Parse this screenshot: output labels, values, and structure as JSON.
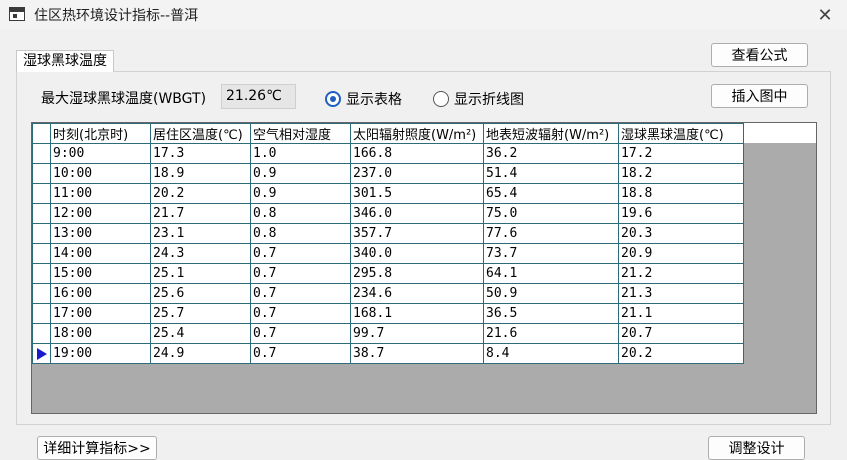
{
  "window": {
    "title": "住区热环境设计指标--普洱",
    "close_glyph": "✕"
  },
  "group": {
    "label": "湿球黑球温度"
  },
  "buttons": {
    "view_formula": "查看公式",
    "insert_figure": "插入图中",
    "details": "详细计算指标>>",
    "adjust_design": "调整设计"
  },
  "max_wbgt": {
    "label": "最大湿球黑球温度(WBGT)",
    "value": "21.26℃"
  },
  "view_mode": {
    "table_label": "显示表格",
    "line_label": "显示折线图",
    "selected": "table"
  },
  "table": {
    "columns": [
      "时刻(北京时)",
      "居住区温度(℃)",
      "空气相对湿度",
      "太阳辐射照度(W/m²)",
      "地表短波辐射(W/m²)",
      "湿球黑球温度(℃)"
    ],
    "rows": [
      [
        "9:00",
        "17.3",
        "1.0",
        "166.8",
        "36.2",
        "17.2"
      ],
      [
        "10:00",
        "18.9",
        "0.9",
        "237.0",
        "51.4",
        "18.2"
      ],
      [
        "11:00",
        "20.2",
        "0.9",
        "301.5",
        "65.4",
        "18.8"
      ],
      [
        "12:00",
        "21.7",
        "0.8",
        "346.0",
        "75.0",
        "19.6"
      ],
      [
        "13:00",
        "23.1",
        "0.8",
        "357.7",
        "77.6",
        "20.3"
      ],
      [
        "14:00",
        "24.3",
        "0.7",
        "340.0",
        "73.7",
        "20.9"
      ],
      [
        "15:00",
        "25.1",
        "0.7",
        "295.8",
        "64.1",
        "21.2"
      ],
      [
        "16:00",
        "25.6",
        "0.7",
        "234.6",
        "50.9",
        "21.3"
      ],
      [
        "17:00",
        "25.7",
        "0.7",
        "168.1",
        "36.5",
        "21.1"
      ],
      [
        "18:00",
        "25.4",
        "0.7",
        "99.7",
        "21.6",
        "20.7"
      ],
      [
        "19:00",
        "24.9",
        "0.7",
        "38.7",
        "8.4",
        "20.2"
      ]
    ],
    "current_row": 10
  }
}
